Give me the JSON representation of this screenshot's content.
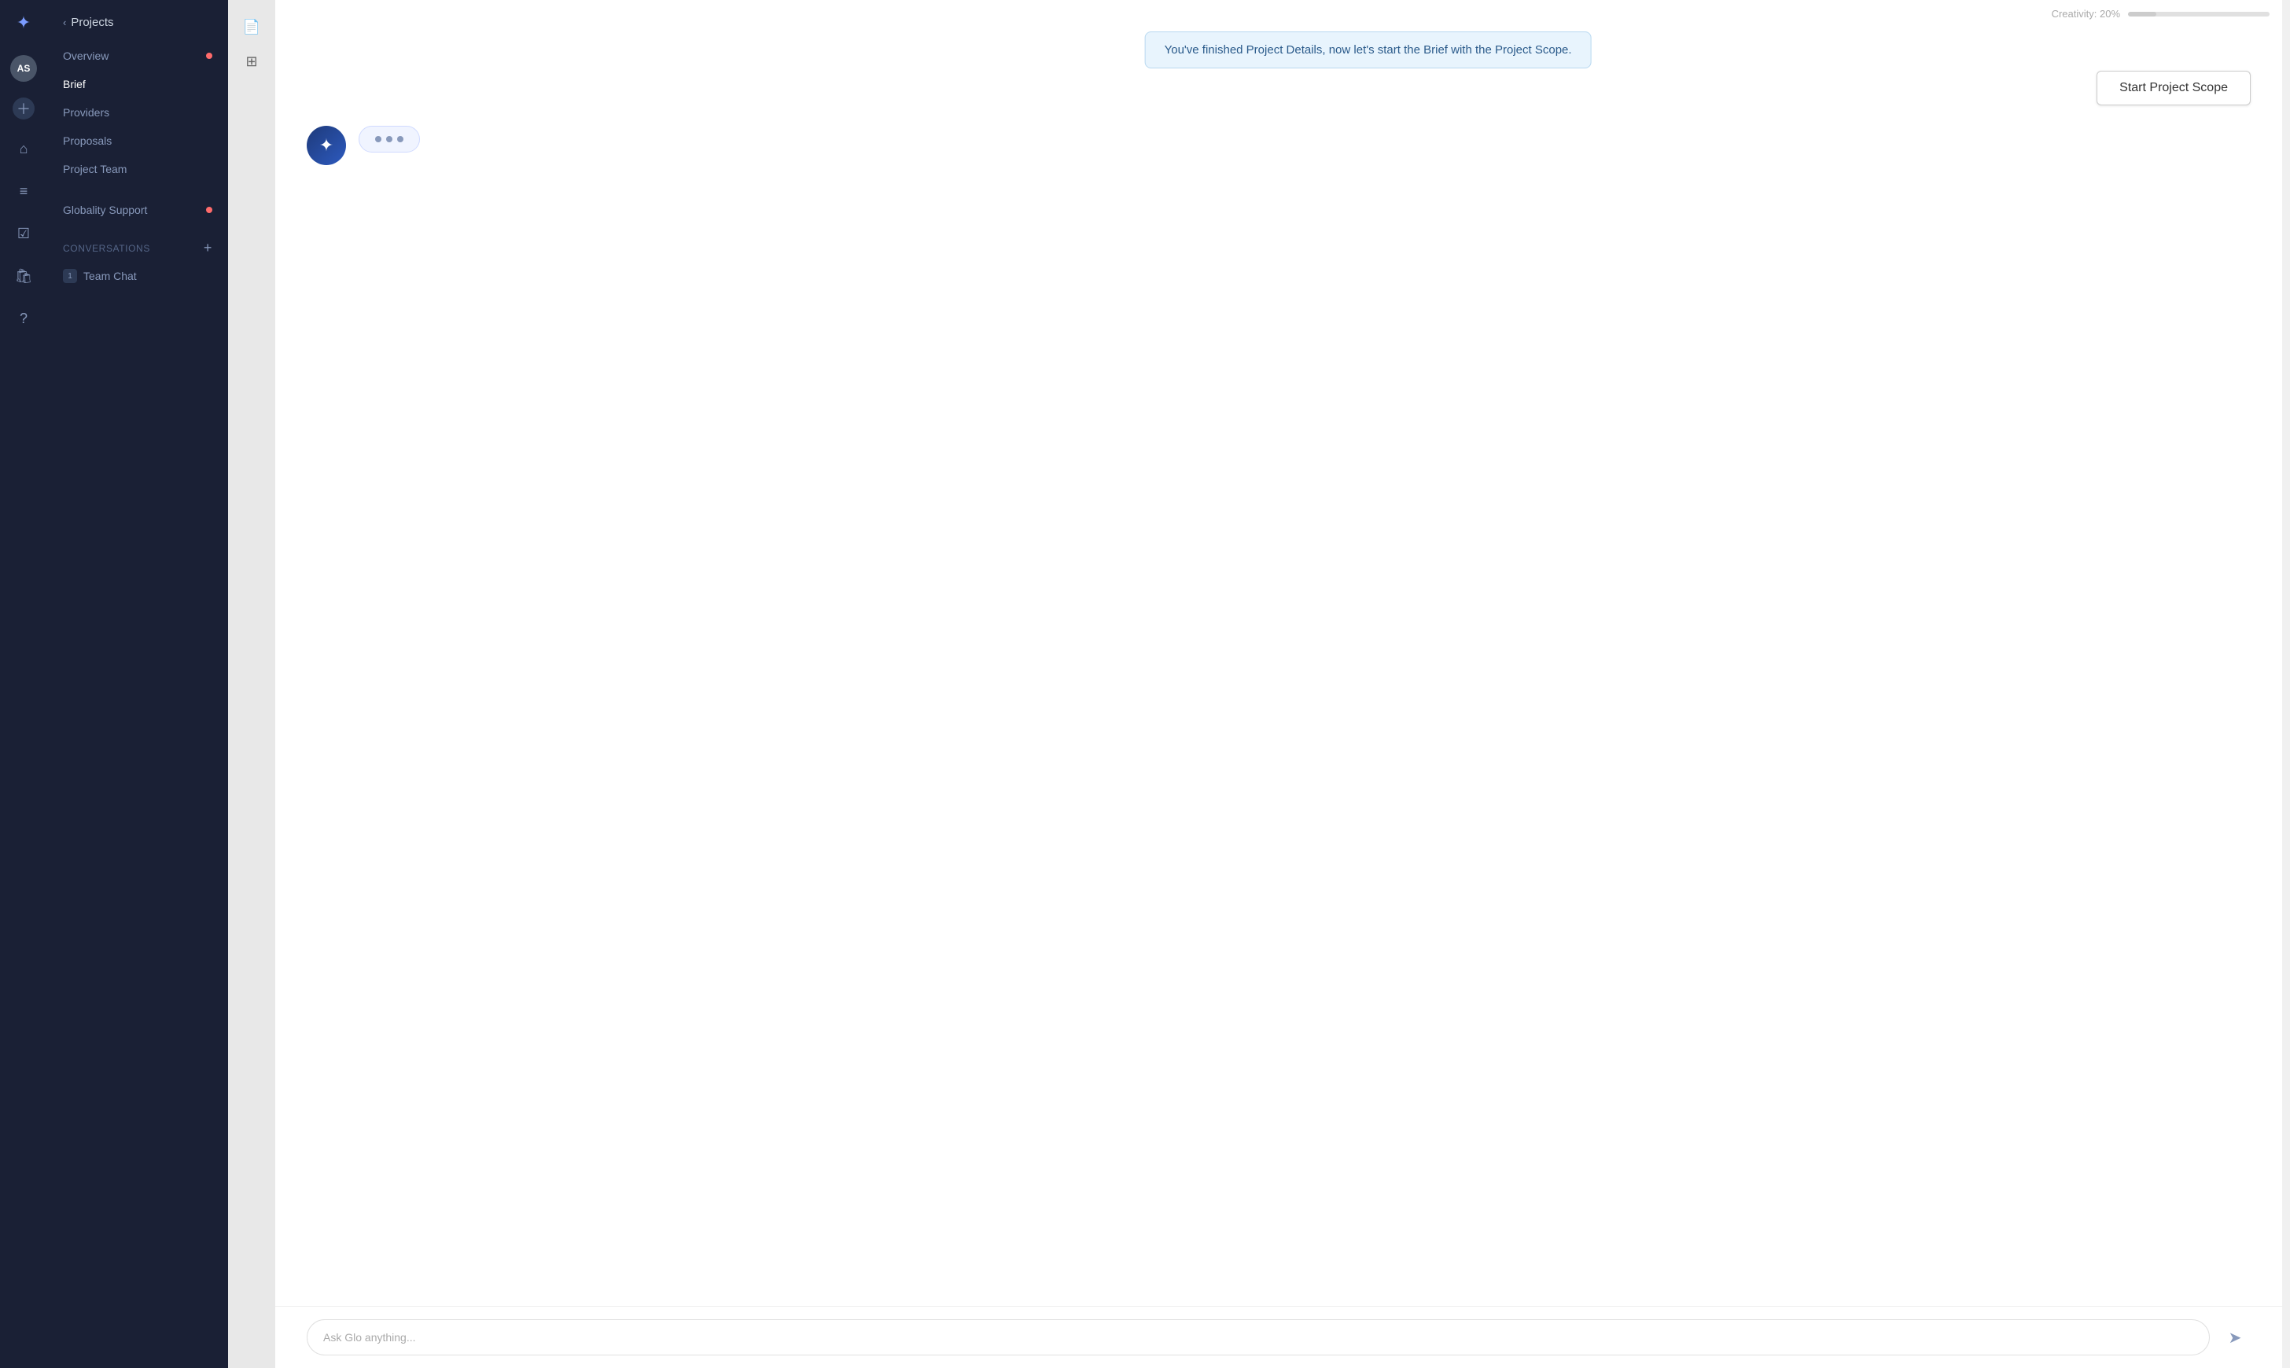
{
  "app": {
    "logo_icon": "✦",
    "title": "Projects"
  },
  "user": {
    "initials": "AS"
  },
  "sidebar": {
    "back_label": "Projects",
    "items": [
      {
        "id": "overview",
        "label": "Overview",
        "active": false,
        "has_dot": true
      },
      {
        "id": "brief",
        "label": "Brief",
        "active": true,
        "has_dot": false
      },
      {
        "id": "providers",
        "label": "Providers",
        "active": false,
        "has_dot": false
      },
      {
        "id": "proposals",
        "label": "Proposals",
        "active": false,
        "has_dot": false
      },
      {
        "id": "project-team",
        "label": "Project Team",
        "active": false,
        "has_dot": false
      }
    ],
    "globality_support_label": "Globality Support",
    "globality_support_dot": true,
    "conversations_label": "Conversations",
    "conversations": [
      {
        "id": "team-chat",
        "label": "Team Chat",
        "num": "1",
        "has_dot": true
      }
    ]
  },
  "top_bar": {
    "creativity_label": "Creativity: 20%",
    "creativity_percent": 20
  },
  "notification": {
    "message": "You've finished Project Details, now let's start the Brief with the Project Scope."
  },
  "start_button": {
    "label": "Start Project Scope"
  },
  "chat": {
    "typing_dots": 3
  },
  "input": {
    "placeholder": "Ask Glo anything..."
  },
  "icons": {
    "send": "➤",
    "doc": "📄",
    "expand": "⊞",
    "star": "✦"
  }
}
